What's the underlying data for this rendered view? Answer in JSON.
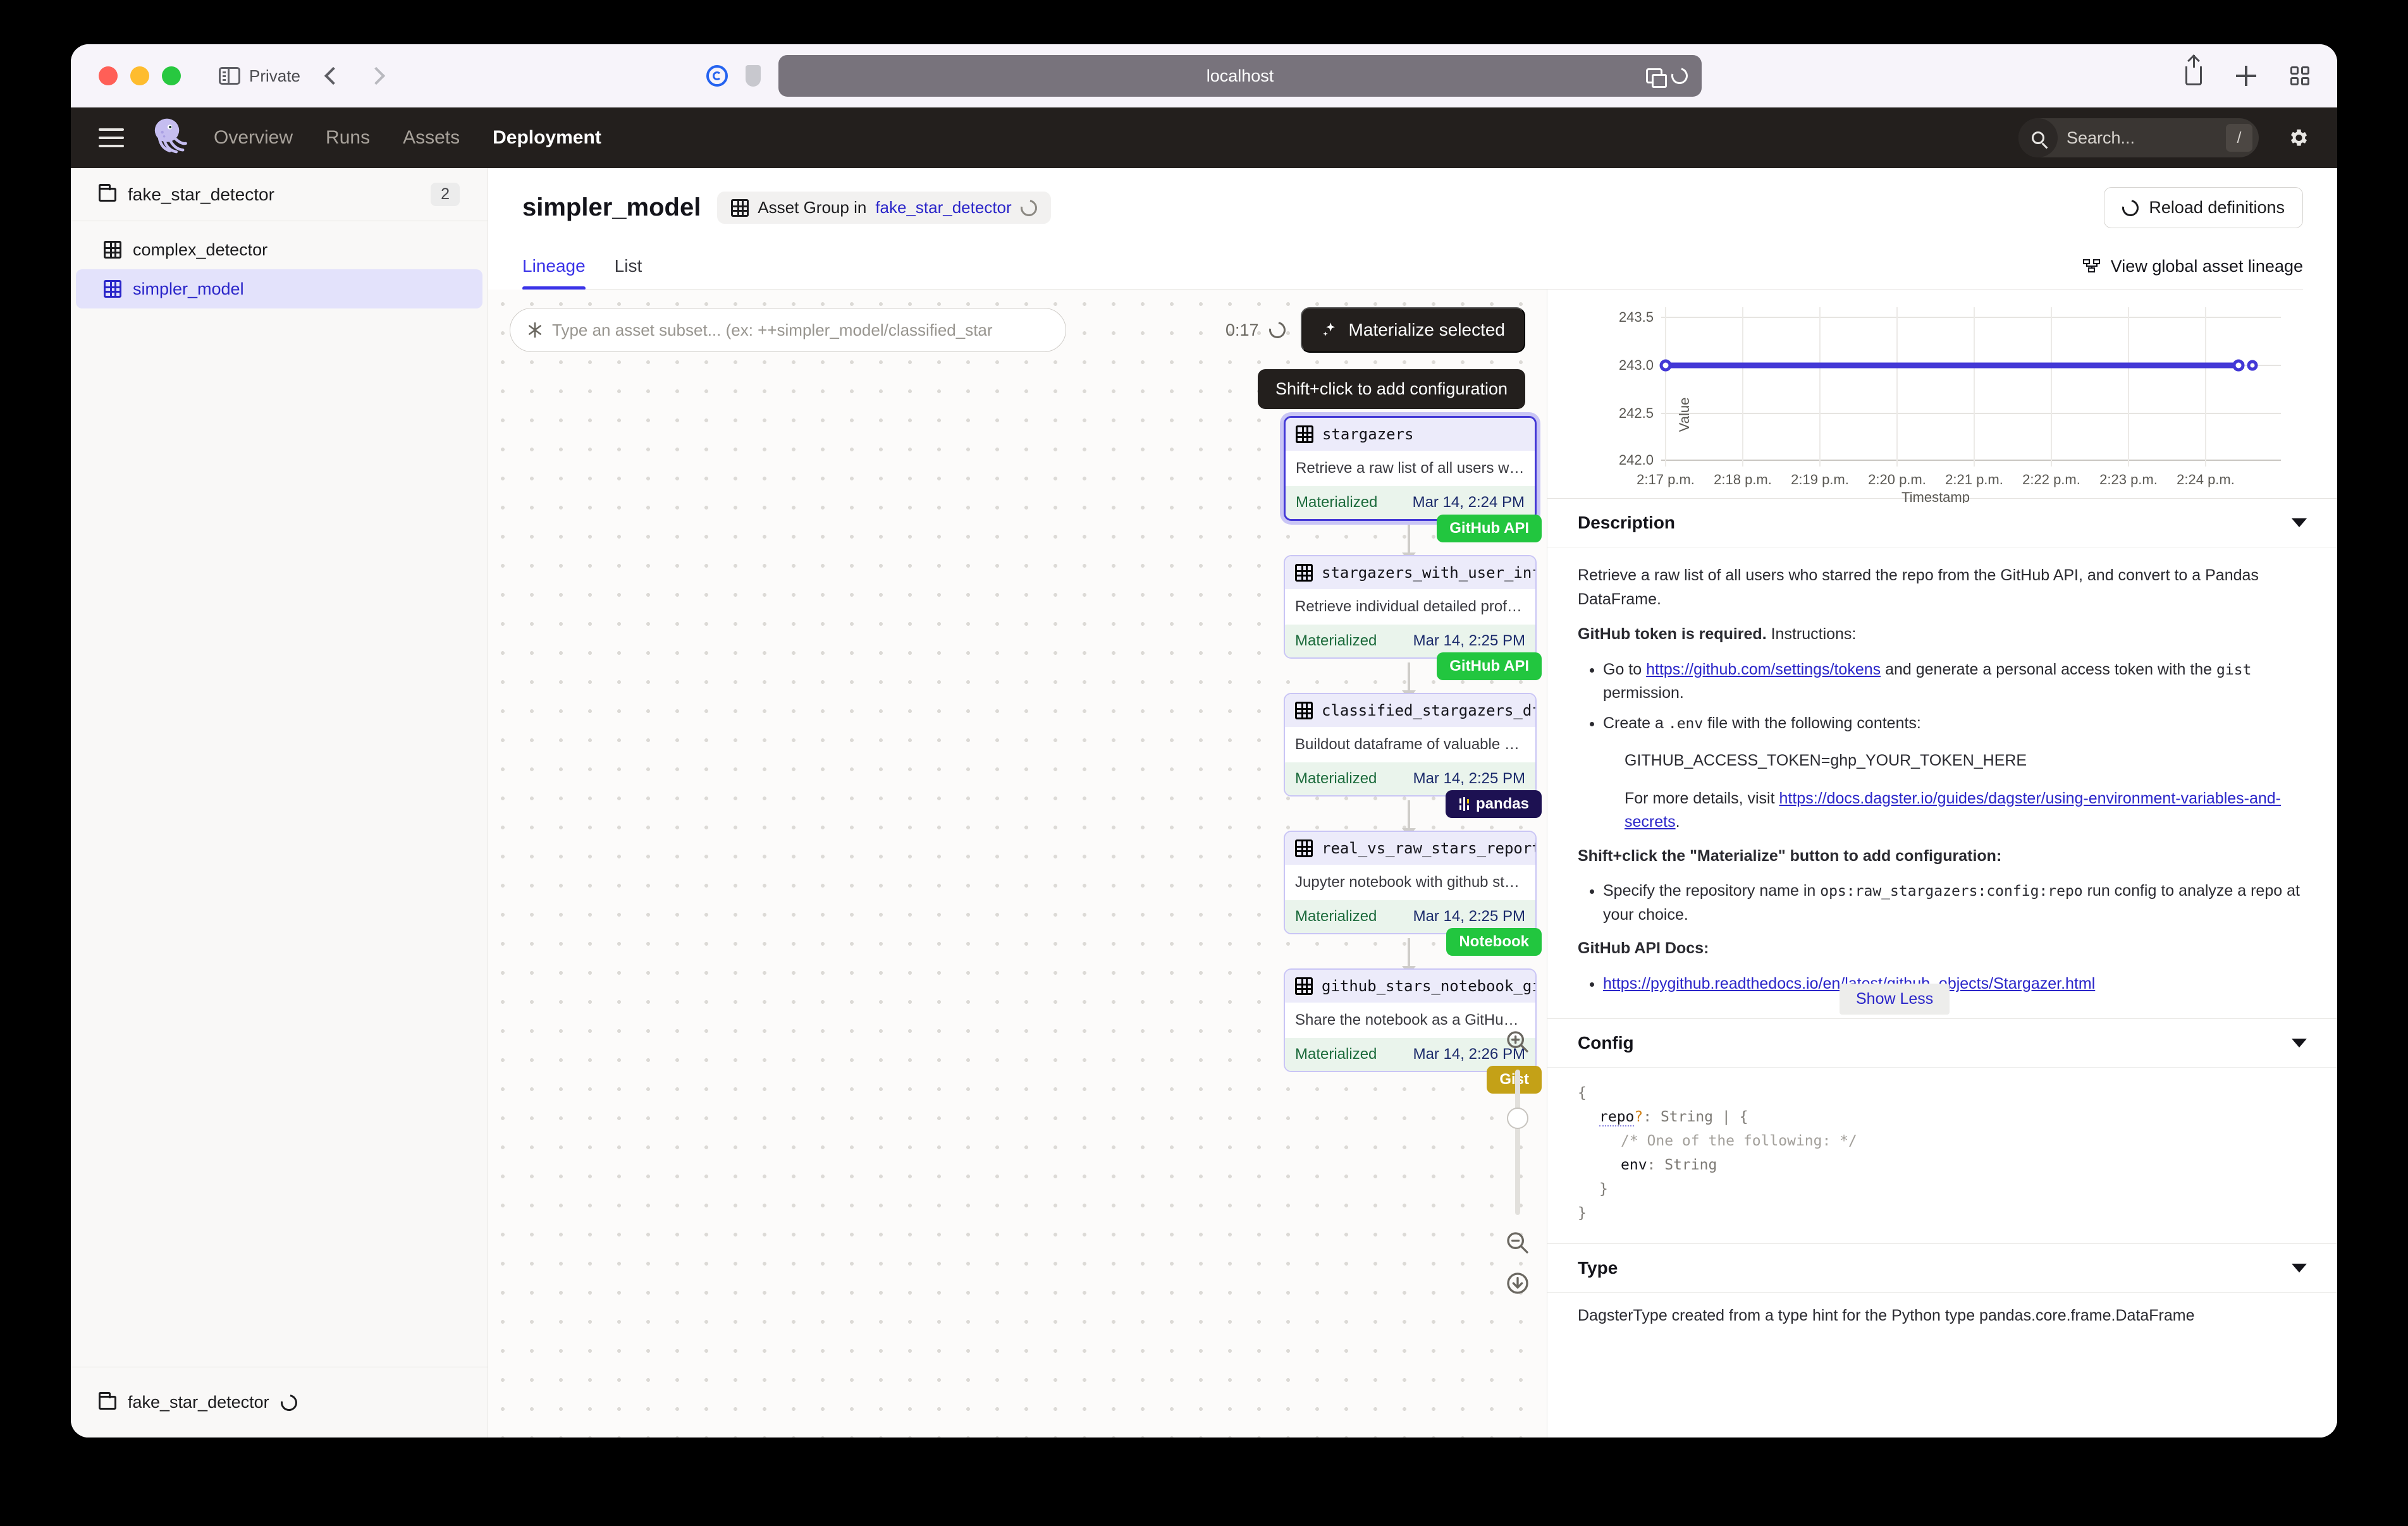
{
  "browser": {
    "private_label": "Private",
    "url": "localhost",
    "icons": [
      "sidebar-toggle-icon",
      "back-chevron-icon",
      "forward-chevron-icon",
      "reader-icon",
      "shield-icon",
      "translate-icon",
      "reload-icon",
      "share-icon",
      "new-tab-icon",
      "tab-overview-icon"
    ]
  },
  "topnav": {
    "links": [
      {
        "label": "Overview",
        "active": false
      },
      {
        "label": "Runs",
        "active": false
      },
      {
        "label": "Assets",
        "active": false
      },
      {
        "label": "Deployment",
        "active": true
      }
    ],
    "search_placeholder": "Search...",
    "search_shortcut": "/",
    "logo_name": "dagster-logo",
    "gear_name": "settings-gear-icon"
  },
  "sidebar": {
    "group": {
      "label": "fake_star_detector",
      "count": "2"
    },
    "items": [
      {
        "label": "complex_detector",
        "active": false
      },
      {
        "label": "simpler_model",
        "active": true
      }
    ],
    "footer": {
      "label": "fake_star_detector"
    }
  },
  "header": {
    "title": "simpler_model",
    "badge_prefix": "Asset Group in",
    "badge_link": "fake_star_detector",
    "reload_button": "Reload definitions"
  },
  "tabs": [
    {
      "label": "Lineage",
      "active": true
    },
    {
      "label": "List",
      "active": false
    }
  ],
  "global_lineage_link": "View global asset lineage",
  "graph_toolbar": {
    "asset_placeholder": "Type an asset subset... (ex: ++simpler_model/classified_star",
    "timer": "0:17",
    "materialize_button": "Materialize selected",
    "tooltip": "Shift+click to add configuration"
  },
  "nodes": [
    {
      "name": "stargazers",
      "description": "Retrieve a raw list of all users who st...",
      "status": "Materialized",
      "timestamp": "Mar 14, 2:24 PM",
      "tag": "GitHub API",
      "tag_kind": "github",
      "selected": true
    },
    {
      "name": "stargazers_with_user_info",
      "description": "Retrieve individual detailed profiles o...",
      "status": "Materialized",
      "timestamp": "Mar 14, 2:25 PM",
      "tag": "GitHub API",
      "tag_kind": "github",
      "selected": false
    },
    {
      "name": "classified_stargazers_df",
      "description": "Buildout dataframe of valuable attrib...",
      "status": "Materialized",
      "timestamp": "Mar 14, 2:25 PM",
      "tag": "pandas",
      "tag_kind": "pandas",
      "selected": false
    },
    {
      "name": "real_vs_raw_stars_report",
      "description": "Jupyter notebook with github star pl...",
      "status": "Materialized",
      "timestamp": "Mar 14, 2:25 PM",
      "tag": "Notebook",
      "tag_kind": "notebook",
      "selected": false
    },
    {
      "name": "github_stars_notebook_gist",
      "description": "Share the notebook as a GitHub Gist.",
      "status": "Materialized",
      "timestamp": "Mar 14, 2:26 PM",
      "tag": "Gist",
      "tag_kind": "gist",
      "selected": false
    }
  ],
  "chart_data": {
    "type": "line",
    "title": "",
    "xlabel": "Timestamp",
    "ylabel": "Value",
    "x": [
      "2:17 p.m.",
      "2:18 p.m.",
      "2:19 p.m.",
      "2:20 p.m.",
      "2:21 p.m.",
      "2:22 p.m.",
      "2:23 p.m.",
      "2:24 p.m."
    ],
    "xtick_labels": [
      "2:17 p.m.",
      "2:18 p.m.",
      "2:19 p.m.",
      "2:20 p.m.",
      "2:21 p.m.",
      "2:22 p.m.",
      "2:23 p.m.",
      "2:24 p.m."
    ],
    "ytick_labels": [
      "243.5",
      "243.0",
      "242.5",
      "242.0"
    ],
    "ylim": [
      242.0,
      243.5
    ],
    "series": [
      {
        "name": "Value",
        "values": [
          243.0,
          243.0,
          243.0,
          243.0,
          243.0,
          243.0,
          243.0,
          243.0
        ],
        "color": "#4338d6"
      }
    ],
    "markers_x": [
      0.0,
      0.955,
      1.0
    ],
    "grid": true,
    "legend": "none"
  },
  "description_panel": {
    "heading": "Description",
    "para1": "Retrieve a raw list of all users who starred the repo from the GitHub API, and convert to a Pandas DataFrame.",
    "bold1": "GitHub token is required.",
    "after_bold1": " Instructions:",
    "bullet1_a": "Go to ",
    "bullet1_link": "https://github.com/settings/tokens",
    "bullet1_b": " and generate a personal access token with the ",
    "bullet1_code": "gist",
    "bullet1_c": " permission.",
    "bullet2_a": "Create a ",
    "bullet2_code": ".env",
    "bullet2_b": " file with the following contents:",
    "env_line": "GITHUB_ACCESS_TOKEN=ghp_YOUR_TOKEN_HERE",
    "more_details_a": "For more details, visit ",
    "more_details_link": "https://docs.dagster.io/guides/dagster/using-environment-variables-and-secrets",
    "more_details_b": ".",
    "bold2": "Shift+click the \"Materialize\" button to add configuration:",
    "bullet3_a": "Specify the repository name in ",
    "bullet3_code": "ops:raw_stargazers:config:repo",
    "bullet3_b": " run config to analyze a repo at your choice.",
    "bold3": "GitHub API Docs:",
    "bullet4_link": "https://pygithub.readthedocs.io/en/latest/github_objects/Stargazer.html",
    "show_less": "Show Less"
  },
  "config_panel": {
    "heading": "Config",
    "line1": "{",
    "line2_key": "repo",
    "line2_q": "?",
    "line2_rest": ": String | {",
    "line3": "/* One of the following: */",
    "line4_key": "env",
    "line4_rest": ": String",
    "line5": "}",
    "line6": "}"
  },
  "type_panel": {
    "heading": "Type",
    "body": "DagsterType created from a type hint for the Python type pandas.core.frame.DataFrame"
  }
}
